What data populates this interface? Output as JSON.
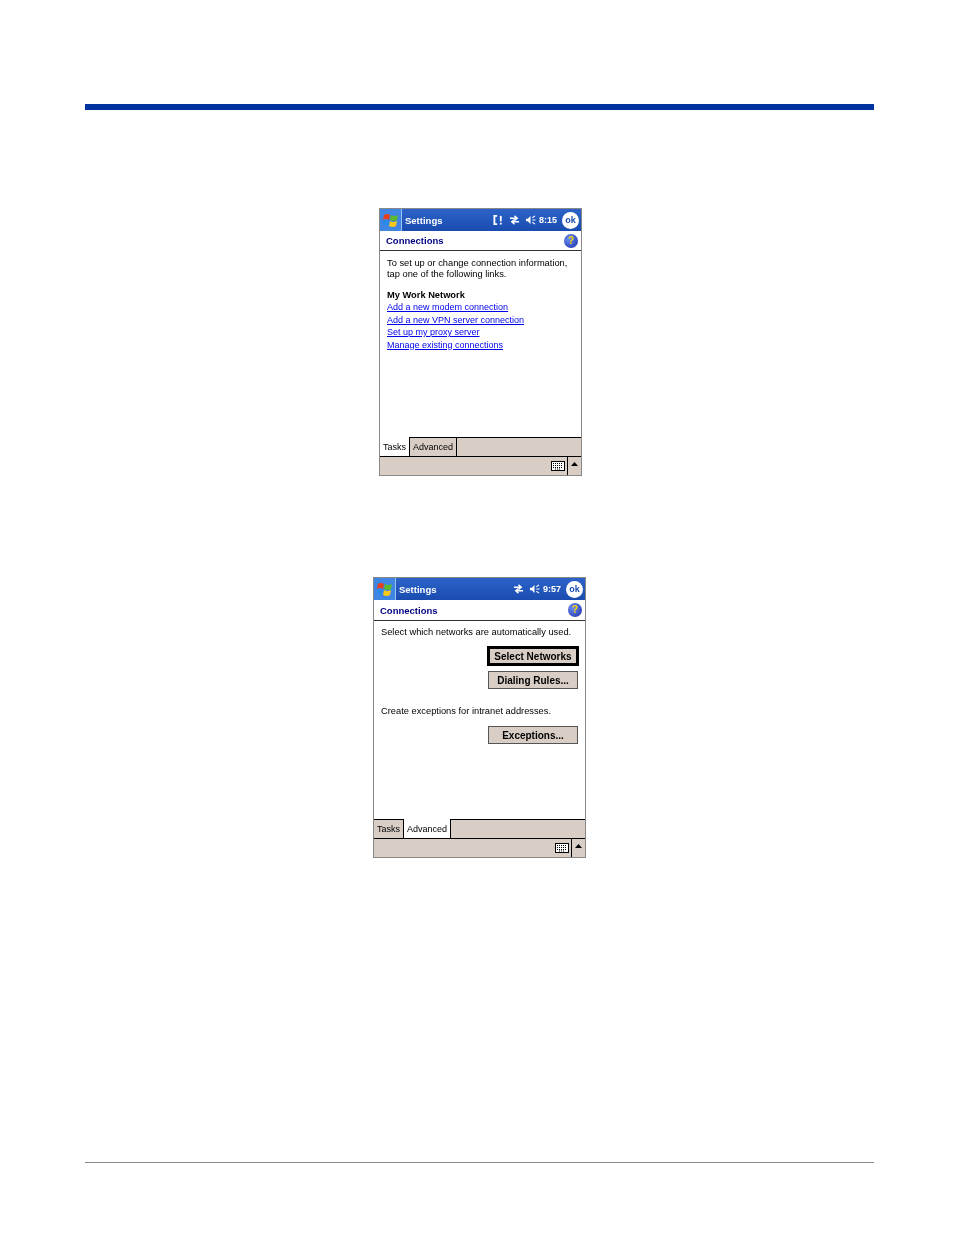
{
  "screens": [
    {
      "title": "Settings",
      "status_icons": [
        {
          "kind": "connection"
        },
        {
          "kind": "sync"
        },
        {
          "kind": "volume"
        }
      ],
      "time": "8:15",
      "ok_button": "ok",
      "header": "Connections",
      "help_button": "?",
      "content": [
        {
          "kind": "text",
          "text": "To set up or change connection information, tap one of the following links."
        },
        {
          "kind": "heading",
          "text": "My Work Network"
        },
        {
          "kind": "link",
          "text": "Add a new modem connection"
        },
        {
          "kind": "link",
          "text": "Add a new VPN server connection"
        },
        {
          "kind": "link",
          "text": "Set up my proxy server"
        },
        {
          "kind": "link",
          "text": "Manage existing connections"
        }
      ],
      "tabs": [
        {
          "label": "Tasks",
          "selected": true
        },
        {
          "label": "Advanced",
          "selected": false
        }
      ]
    },
    {
      "title": "Settings",
      "status_icons": [
        {
          "kind": "sync"
        },
        {
          "kind": "volume"
        }
      ],
      "time": "9:57",
      "ok_button": "ok",
      "header": "Connections",
      "help_button": "?",
      "content": [
        {
          "kind": "text",
          "text": "Select which networks are automatically used."
        },
        {
          "kind": "button",
          "text": "Select Networks",
          "focused": true
        },
        {
          "kind": "button",
          "text": "Dialing Rules...",
          "focused": false
        },
        {
          "kind": "text",
          "text": "Create exceptions for intranet addresses."
        },
        {
          "kind": "button",
          "text": "Exceptions...",
          "focused": false
        }
      ],
      "tabs": [
        {
          "label": "Tasks",
          "selected": false
        },
        {
          "label": "Advanced",
          "selected": true
        }
      ]
    }
  ]
}
